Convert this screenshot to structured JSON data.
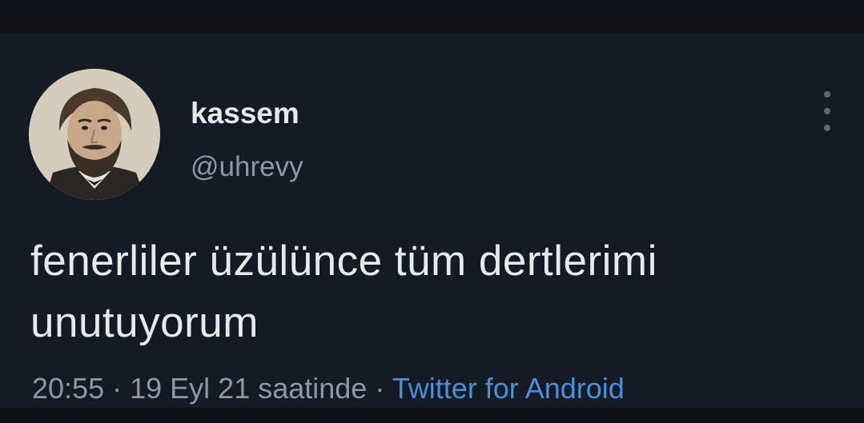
{
  "tweet": {
    "display_name": "kassem",
    "handle": "@uhrevy",
    "text_line1": "fenerliler üzülünce tüm dertlerimi",
    "text_line2": "unutuyorum",
    "time": "20:55",
    "separator": "·",
    "date": "19 Eyl 21 saatinde",
    "source": "Twitter for Android"
  },
  "icons": {
    "more": "more-options-icon",
    "avatar": "avatar-portrait"
  },
  "colors": {
    "background": "#151b24",
    "text": "#e7e9ea",
    "muted": "#8b98a5",
    "link": "#4b8fd8"
  }
}
